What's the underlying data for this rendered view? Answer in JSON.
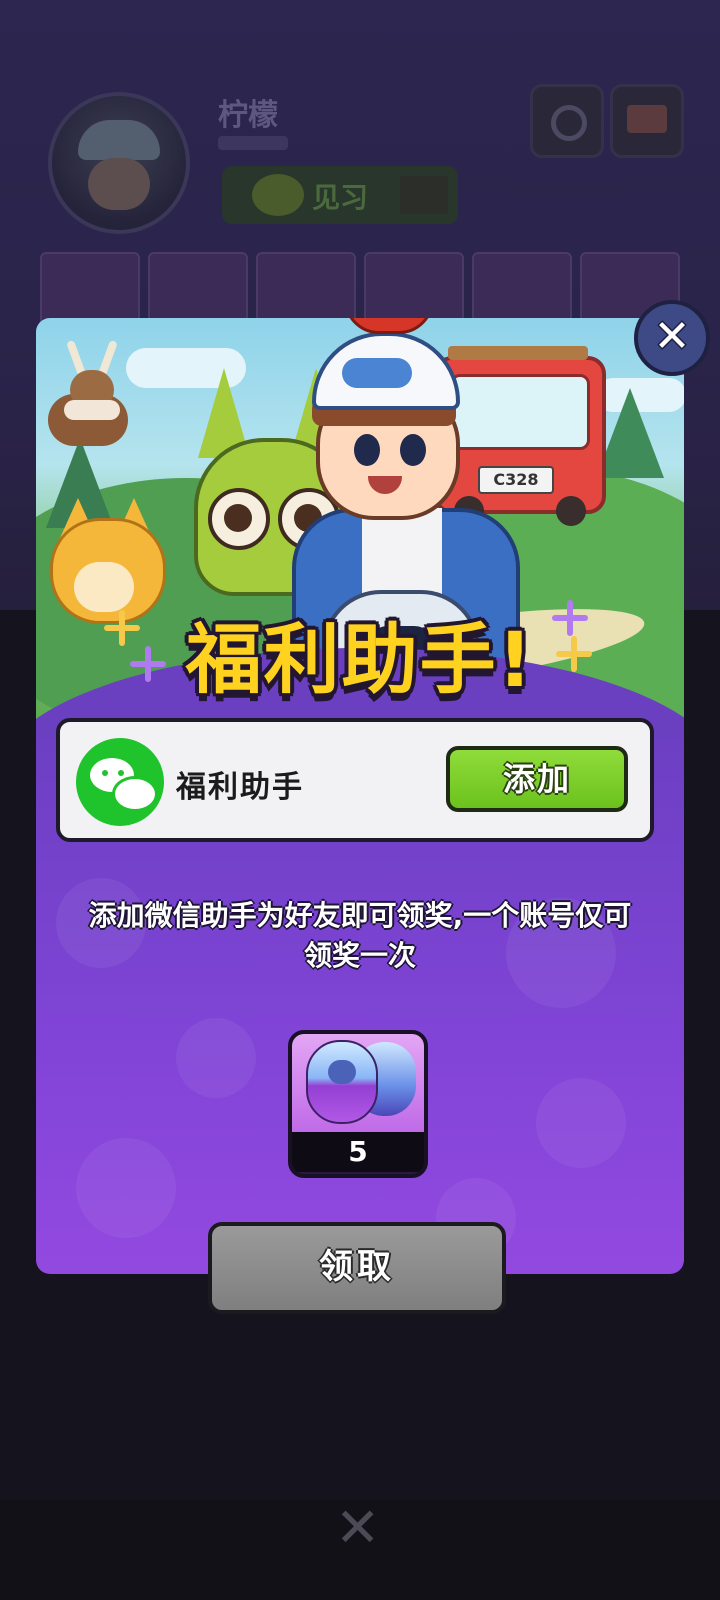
{
  "background": {
    "player_name": "柠檬",
    "rank_label": "见习"
  },
  "popup": {
    "title": "福利助手!",
    "contact_name": "福利助手",
    "add_button": "添加",
    "description": "添加微信助手为好友即可领奖,一个账号仅可领奖一次",
    "reward": {
      "icon": "capsule-ball-icon",
      "count": "5"
    },
    "claim_button": "领取",
    "close_symbol": "✕"
  },
  "bottom_close_symbol": "✕",
  "icons": {
    "wechat": "wechat-icon",
    "gear": "gear-icon",
    "mail": "mail-icon"
  },
  "colors": {
    "title_yellow": "#ffd21f",
    "add_green": "#7ccf2b",
    "wechat_green": "#1fc32b",
    "popup_purple": "#6a3fc0",
    "claim_gray": "#8c8c8c"
  }
}
